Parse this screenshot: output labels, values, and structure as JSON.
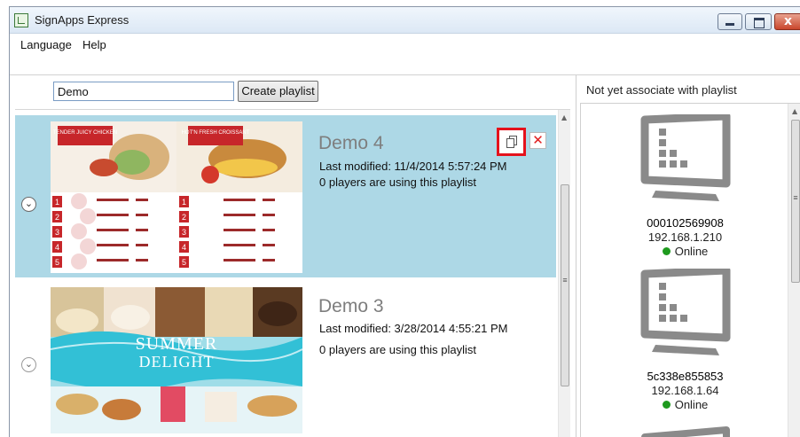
{
  "window": {
    "title": "SignApps Express"
  },
  "menu": {
    "items": [
      "Language",
      "Help"
    ]
  },
  "toolbar": {
    "search_value": "Demo",
    "create_label": "Create playlist"
  },
  "playlists": [
    {
      "name": "Demo 4",
      "last_modified": "Last modified: 11/4/2014 5:57:24 PM",
      "players": "0 players are using this playlist",
      "selected": true,
      "expander": "chevron-down-icon",
      "thumb_labels": {
        "left_tag": "TENDER JUICY CHICKEN",
        "right_tag": "HOT'N FRESH CROISSANT",
        "nums": [
          "1",
          "2",
          "3",
          "4",
          "5"
        ]
      }
    },
    {
      "name": "Demo 3",
      "last_modified": "Last modified: 3/28/2014 4:55:21 PM",
      "players": "0 players are using this playlist",
      "selected": false,
      "expander": "chevron-down-icon",
      "thumb_labels": {
        "line1": "SUMMER",
        "line2": "DELIGHT"
      }
    }
  ],
  "actions": {
    "copy_icon": "copy-icon",
    "delete_glyph": "✕"
  },
  "right_panel": {
    "header": "Not yet associate with playlist",
    "players": [
      {
        "id": "000102569908",
        "ip": "192.168.1.210",
        "status": "Online"
      },
      {
        "id": "5c338e855853",
        "ip": "192.168.1.64",
        "status": "Online"
      }
    ]
  },
  "colors": {
    "selected_row": "#add8e6",
    "online": "#1e9a1e",
    "highlight": "#e5121c",
    "delete": "#e11d1d"
  }
}
